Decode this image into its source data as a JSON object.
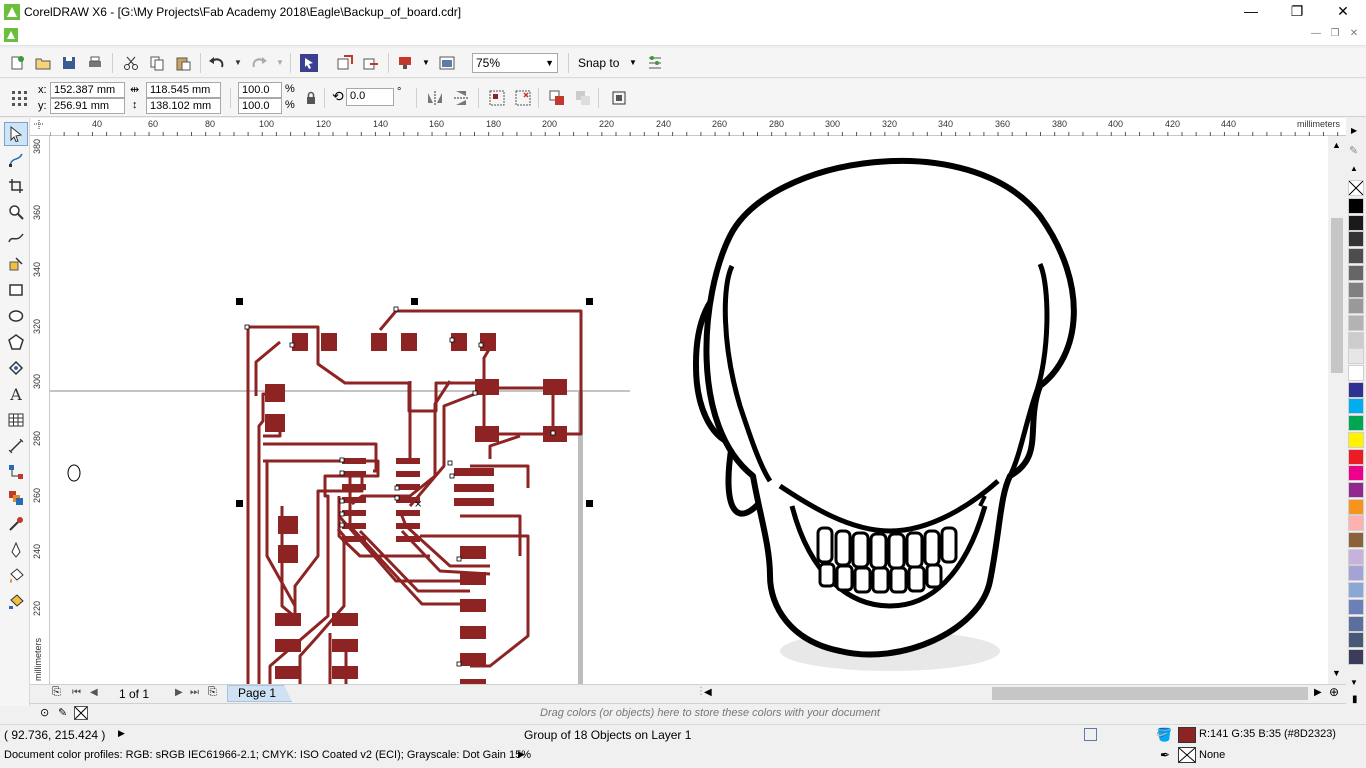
{
  "window": {
    "title": "CorelDRAW X6 - [G:\\My Projects\\Fab Academy 2018\\Eagle\\Backup_of_board.cdr]",
    "minimize": "—",
    "maximize": "❐",
    "close": "✕"
  },
  "standard_toolbar": {
    "zoom_level": "75%",
    "snap_to": "Snap to"
  },
  "property_bar": {
    "x_label": "x:",
    "x_value": "152.387 mm",
    "y_label": "y:",
    "y_value": "256.91 mm",
    "width_value": "118.545 mm",
    "height_value": "138.102 mm",
    "scale_x": "100.0",
    "scale_y": "100.0",
    "percent": "%",
    "rotation": "0.0",
    "degree": "°"
  },
  "rulers": {
    "units": "millimeters",
    "top_ticks": [
      "40",
      "60",
      "80",
      "100",
      "120",
      "140",
      "160",
      "180",
      "200",
      "220",
      "240",
      "260",
      "280",
      "300",
      "320",
      "340",
      "360",
      "380",
      "400",
      "420",
      "440"
    ],
    "left_ticks": [
      "380",
      "360",
      "340",
      "320",
      "300",
      "280",
      "260",
      "240",
      "220"
    ]
  },
  "page_nav": {
    "page_count": "1 of 1",
    "page_tab": "Page 1"
  },
  "document_palette": {
    "hint": "Drag colors (or objects) here to store these colors with your document"
  },
  "status": {
    "cursor_coords": "( 92.736, 215.424 )",
    "selection_info": "Group of 18 Objects on Layer 1",
    "fill_color": "R:141 G:35 B:35 (#8D2323)",
    "outline": "None",
    "color_profiles": "Document color profiles: RGB: sRGB IEC61966-2.1; CMYK: ISO Coated v2 (ECI); Grayscale: Dot Gain 15%"
  },
  "colors": {
    "trace": "#8D2323",
    "accent_tab": "#cfe2f3"
  },
  "palette_colors": [
    "#ffffff",
    "#000000",
    "#1a1a1a",
    "#333333",
    "#4d4d4d",
    "#666666",
    "#808080",
    "#999999",
    "#b3b3b3",
    "#cccccc",
    "#e6e6e6",
    "#ffffff",
    "#2e3192",
    "#00aeef",
    "#00a651",
    "#fff200",
    "#ed1c24",
    "#ec008c",
    "#92278f",
    "#f7941d",
    "#ffb0b0",
    "#8c6239",
    "#c7b2de",
    "#a3a3d6",
    "#8aa7d6",
    "#6b7fb8",
    "#5a6f9c",
    "#4a5878",
    "#3c3c5a"
  ]
}
